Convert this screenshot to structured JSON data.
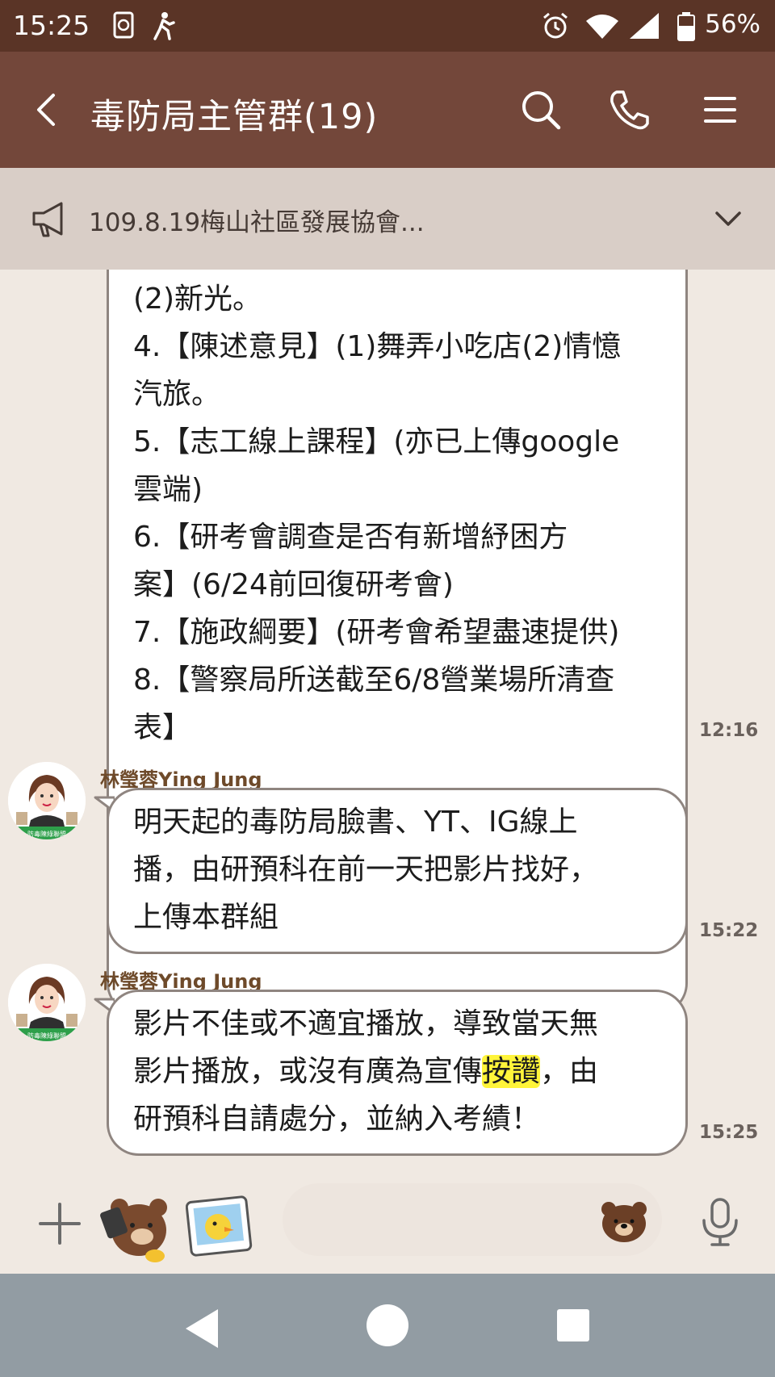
{
  "statusbar": {
    "time": "15:25",
    "battery": "56%"
  },
  "header": {
    "title": "毒防局主管群(19)"
  },
  "notice": {
    "text": "109.8.19梅山社區發展協會..."
  },
  "messages": [
    {
      "lines": [
        "(2)新光。",
        "4.【陳述意見】(1)舞弄小吃店(2)情憶",
        "汽旅。",
        "5.【志工線上課程】(亦已上傳google",
        "雲端)",
        "6.【研考會調查是否有新增紓困方",
        "案】(6/24前回復研考會)",
        "7.【施政綱要】(研考會希望盡速提供)",
        "8.【警察局所送截至6/8營業場所清查",
        "表】"
      ],
      "time": "12:16"
    },
    {
      "sender": "林瑩蓉Ying Jung",
      "lines": [
        "明天起的毒防局臉書、YT、IG線上",
        "播，由研預科在前一天把影片找好，",
        "上傳本群組"
      ],
      "time": "15:22"
    },
    {
      "sender": "林瑩蓉Ying Jung",
      "line1": "影片不佳或不適宜播放，導致當天無",
      "line2_before": "影片播放，或沒有廣為宣傳",
      "line2_highlight": "按讚",
      "line2_after": "，由",
      "line3": "研預科自請處分，並納入考績！",
      "time": "15:25"
    }
  ],
  "input": {
    "placeholder": ""
  },
  "colors": {
    "header": "#73473a",
    "statusbar": "#5a3426",
    "highlight": "#fff43a",
    "chat_bg": "#f0e9e2"
  }
}
